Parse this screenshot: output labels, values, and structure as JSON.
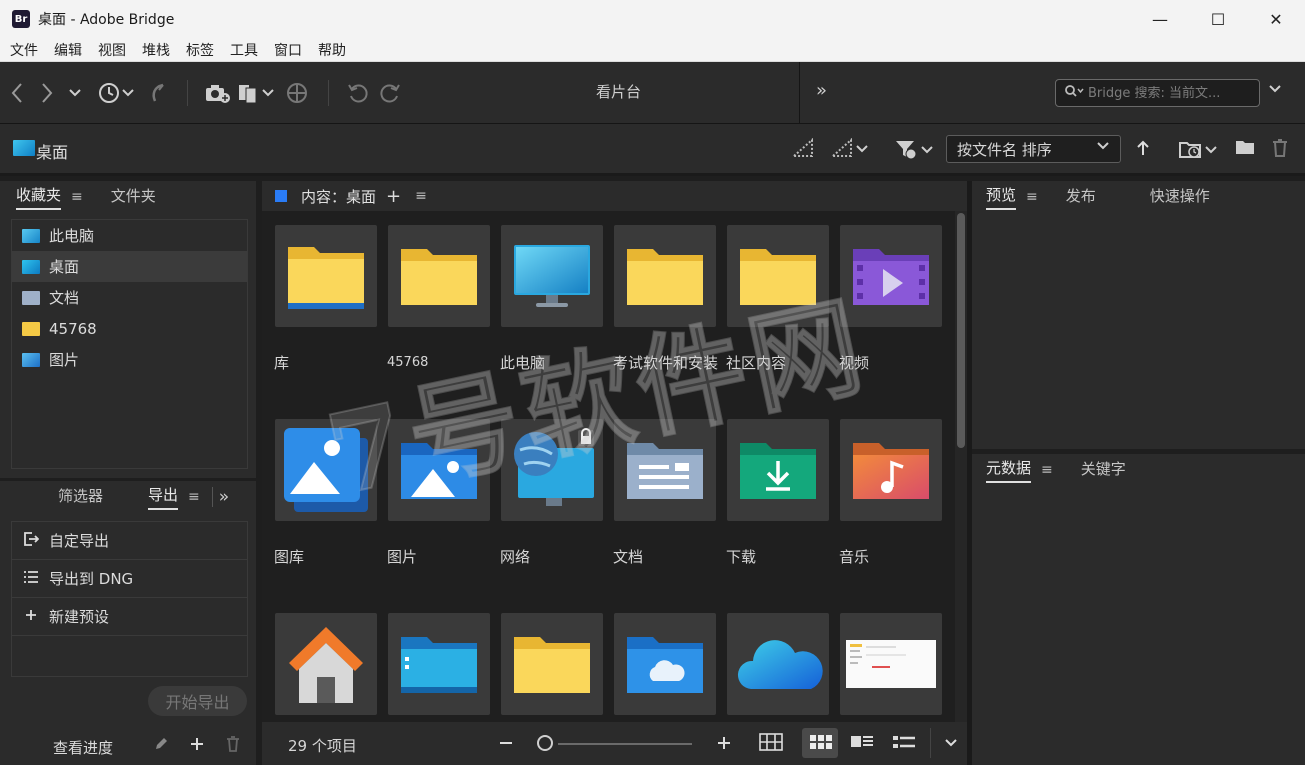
{
  "window": {
    "app_badge": "Br",
    "title": "桌面 - Adobe Bridge",
    "minimize": "—",
    "maximize": "☐",
    "close": "✕"
  },
  "menu": [
    "文件",
    "编辑",
    "视图",
    "堆栈",
    "标签",
    "工具",
    "窗口",
    "帮助"
  ],
  "toolbar": {
    "workspace": "看片台",
    "more": "»",
    "search_placeholder": "Bridge 搜索: 当前文..."
  },
  "path": {
    "current": "桌面",
    "sort_label": "按文件名 排序"
  },
  "favorites_panel": {
    "tabs": [
      "收藏夹",
      "文件夹"
    ],
    "items": [
      {
        "label": "此电脑",
        "icon": "computer-icon"
      },
      {
        "label": "桌面",
        "icon": "desktop-icon"
      },
      {
        "label": "文档",
        "icon": "documents-icon"
      },
      {
        "label": "45768",
        "icon": "folder-icon"
      },
      {
        "label": "图片",
        "icon": "pictures-icon"
      }
    ]
  },
  "export_panel": {
    "tabs": [
      "筛选器",
      "导出"
    ],
    "more": "»",
    "items": [
      {
        "label": "自定导出",
        "icon": "export-icon"
      },
      {
        "label": "导出到 DNG",
        "icon": "list-icon"
      },
      {
        "label": "新建预设",
        "icon": "plus-icon"
      }
    ],
    "start_button": "开始导出",
    "progress_link": "查看进度"
  },
  "content": {
    "header": "内容：桌面",
    "items": [
      {
        "label": "库",
        "icon": "library-folder-icon"
      },
      {
        "label": "45768",
        "icon": "folder-icon"
      },
      {
        "label": "此电脑",
        "icon": "computer-icon"
      },
      {
        "label": "考试软件和安装",
        "icon": "folder-icon"
      },
      {
        "label": "社区内容",
        "icon": "folder-icon"
      },
      {
        "label": "视频",
        "icon": "video-folder-icon"
      },
      {
        "label": "图库",
        "icon": "gallery-icon"
      },
      {
        "label": "图片",
        "icon": "pictures-folder-icon"
      },
      {
        "label": "网络",
        "icon": "network-icon"
      },
      {
        "label": "文档",
        "icon": "documents-folder-icon"
      },
      {
        "label": "下载",
        "icon": "downloads-folder-icon"
      },
      {
        "label": "音乐",
        "icon": "music-folder-icon"
      },
      {
        "label": "",
        "icon": "home-icon"
      },
      {
        "label": "",
        "icon": "desktop-folder-icon"
      },
      {
        "label": "",
        "icon": "folder-icon"
      },
      {
        "label": "",
        "icon": "onedrive-folder-icon"
      },
      {
        "label": "",
        "icon": "cloud-icon"
      },
      {
        "label": "",
        "icon": "screenshot-thumbnail"
      }
    ],
    "item_count": "29 个项目"
  },
  "preview_panel": {
    "tabs": [
      "预览",
      "发布",
      "快速操作"
    ]
  },
  "metadata_panel": {
    "tabs": [
      "元数据",
      "关键字"
    ]
  },
  "watermark": "7号软件网",
  "colors": {
    "accent": "#2a7cf6",
    "panel": "#2b2b2b",
    "folder_yellow": "#f6c94a"
  }
}
